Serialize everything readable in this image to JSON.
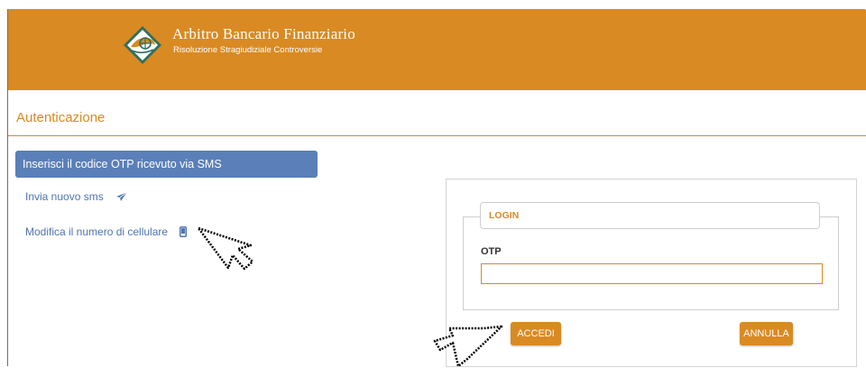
{
  "header": {
    "brand_title": "Arbitro Bancario Finanziario",
    "brand_subtitle": "Risoluzione Stragiudiziale Controversie",
    "background_color": "#d98a22",
    "logo_icon": "abf-logo-icon"
  },
  "page": {
    "section_title": "Autenticazione",
    "accent_color": "#d98a22"
  },
  "sidebar": {
    "banner": "Inserisci il codice OTP ricevuto via SMS",
    "banner_color": "#5b7fb8",
    "links": [
      {
        "label": "Invia nuovo sms",
        "icon": "send-icon"
      },
      {
        "label": "Modifica il numero di cellulare",
        "icon": "mobile-phone-icon"
      }
    ]
  },
  "login": {
    "legend": "LOGIN",
    "otp_label": "OTP",
    "otp_value": "",
    "otp_placeholder": "",
    "submit_label": "ACCEDI",
    "cancel_label": "ANNULLA"
  },
  "overlays": {
    "cursors": [
      "pointer-cursor-icon",
      "pointer-cursor-icon"
    ]
  }
}
